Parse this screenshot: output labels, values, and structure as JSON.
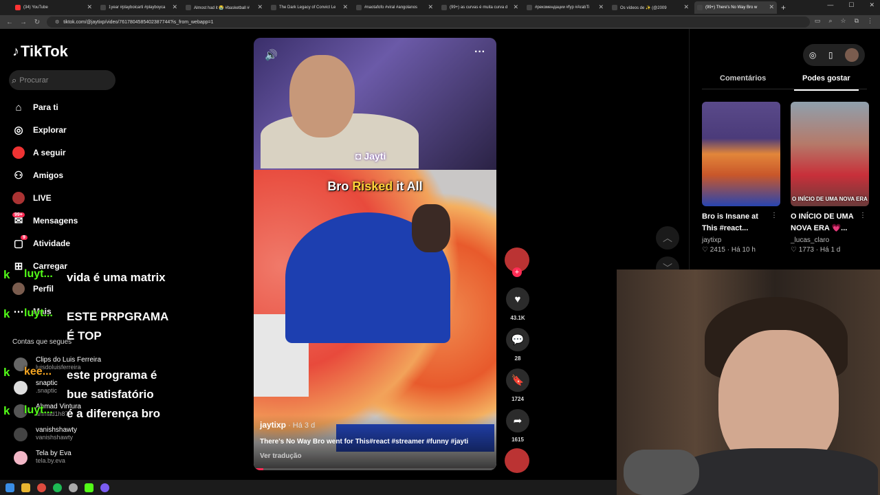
{
  "browser": {
    "tabs": [
      {
        "label": "(34) YouTube",
        "active": false
      },
      {
        "label": "1year #playboicarti #playboyca",
        "active": false
      },
      {
        "label": "Almost had it 😭 #basketball #",
        "active": false
      },
      {
        "label": "The Dark Legacy of Convict Le",
        "active": false
      },
      {
        "label": "#naotafofo #viral #angolanos",
        "active": false
      },
      {
        "label": "(99+) as curvas é muita curva d",
        "active": false
      },
      {
        "label": "#рекомендации #fyp #ArabTi",
        "active": false
      },
      {
        "label": "Os vídeos de ✨ (@2009",
        "active": false
      },
      {
        "label": "(99+) There's No Way Bro w",
        "active": true
      }
    ],
    "url": "tiktok.com/@jaytixp/video/7617804585402387744?is_from_webapp=1"
  },
  "sidebar": {
    "logo": "TikTok",
    "search_placeholder": "Procurar",
    "nav": [
      {
        "label": "Para ti",
        "icon": "home-icon"
      },
      {
        "label": "Explorar",
        "icon": "compass-icon"
      },
      {
        "label": "A seguir",
        "icon": "following-avatar-icon"
      },
      {
        "label": "Amigos",
        "icon": "friends-icon"
      },
      {
        "label": "LIVE",
        "icon": "live-icon"
      },
      {
        "label": "Mensagens",
        "icon": "messages-icon",
        "badge": "99+"
      },
      {
        "label": "Atividade",
        "icon": "activity-icon",
        "badge": "9"
      },
      {
        "label": "Carregar",
        "icon": "upload-icon"
      },
      {
        "label": "Perfil",
        "icon": "profile-avatar-icon"
      },
      {
        "label": "Mais",
        "icon": "more-icon"
      }
    ],
    "following_title": "Contas que segues",
    "following": [
      {
        "name": "Clips do Luis Ferreira",
        "handle": "luisdoluisferreira"
      },
      {
        "name": "snaptic",
        "handle": ".snaptic"
      },
      {
        "name": "Ahmad Vintura",
        "handle": "ahmad1h87"
      },
      {
        "name": "vanishshawty",
        "handle": "vanishshawty"
      },
      {
        "name": "Tela by Eva",
        "handle": "tela.by.eva"
      }
    ]
  },
  "chat": [
    {
      "user": "luyt...",
      "message": "vida é uma matrix",
      "color": "#53fc18"
    },
    {
      "user": "luyt...",
      "message": "ESTE PRPGRAMA É TOP",
      "color": "#53fc18"
    },
    {
      "user": "kee...",
      "message": "este programa é bue satisfatório",
      "color": "#f5a623"
    },
    {
      "user": "luyt...",
      "message": "é a diferença bro",
      "color": "#53fc18"
    }
  ],
  "video": {
    "caption_pre": "Bro ",
    "caption_highlight": "Risked",
    "caption_post": " it All",
    "watermark": "Jayti",
    "author": "jaytixp",
    "ago": " · Há 3 d",
    "description": "There's No Way Bro went for This#react #streamer #funny #jayti",
    "translate": "Ver tradução",
    "progress": 0.04
  },
  "actions": {
    "likes": "43.1K",
    "comments": "28",
    "saves": "1724",
    "shares": "1615"
  },
  "right_panel": {
    "tabs": [
      "Comentários",
      "Podes gostar"
    ],
    "active_tab": "Podes gostar",
    "cards": [
      {
        "title": "Bro is Insane at This #react...",
        "author": "jaytixp",
        "likes": "2415",
        "ago": "Há 10 h",
        "overlay": ""
      },
      {
        "title": "O INÍCIO DE UMA NOVA ERA 💗...",
        "author": "_lucas_claro",
        "likes": "1773",
        "ago": "Há 1 d",
        "overlay": "O INÍCIO DE UMA NOVA ERA"
      }
    ]
  },
  "colors": {
    "accent": "#fe2c55",
    "kick_green": "#53fc18",
    "caption_yellow": "#ffd23a"
  }
}
